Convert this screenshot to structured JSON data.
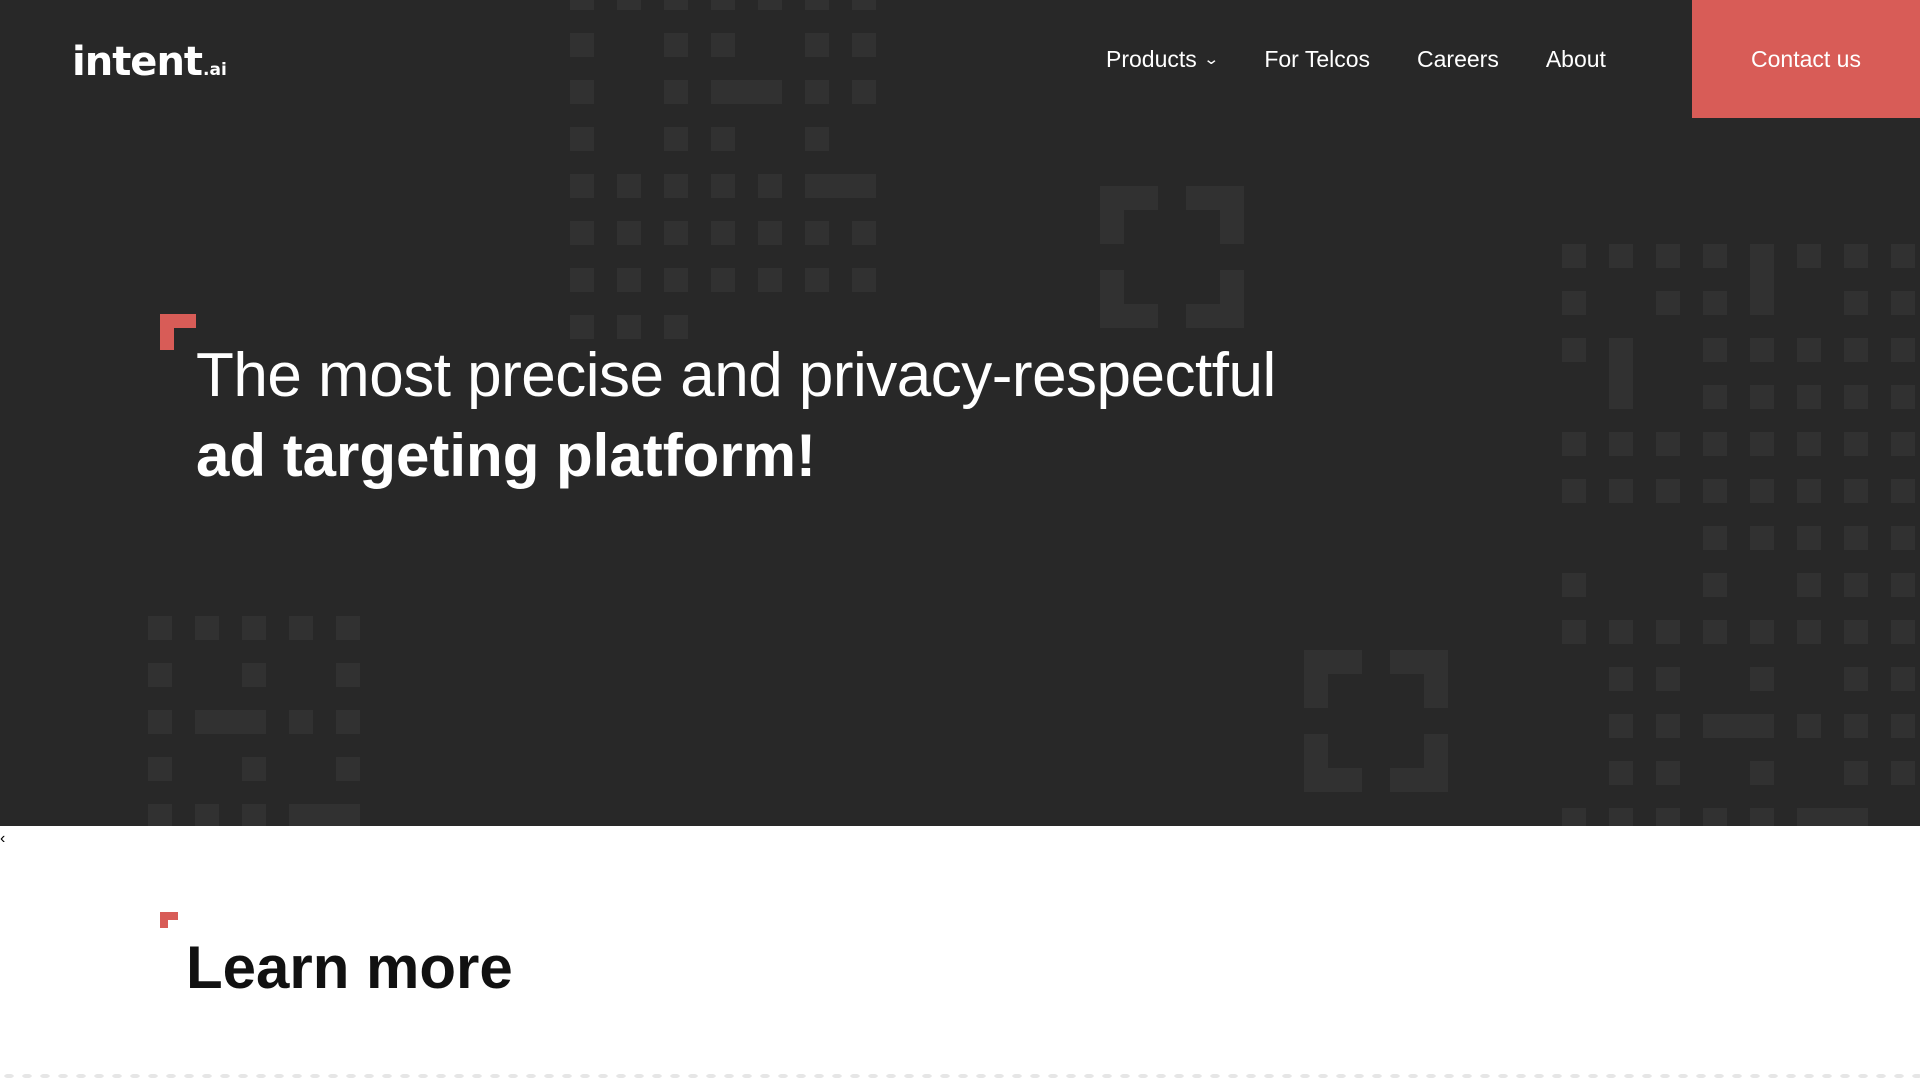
{
  "brand": {
    "logo_main": "intent",
    "logo_suffix": ".ai",
    "accent_color": "#d85c57",
    "hero_background": "#282828"
  },
  "nav": {
    "items": [
      {
        "label": "Products",
        "has_dropdown": true
      },
      {
        "label": "For Telcos",
        "has_dropdown": false
      },
      {
        "label": "Careers",
        "has_dropdown": false
      },
      {
        "label": "About",
        "has_dropdown": false
      }
    ],
    "dropdown_icon": "chevron-down-icon",
    "contact_label": "Contact us"
  },
  "hero": {
    "headline_line1": "The most precise and privacy-respectful",
    "headline_line2": "ad targeting platform!"
  },
  "carousel": {
    "prev_glyph": "‹",
    "prev_icon": "chevron-left-icon"
  },
  "learn_more": {
    "title": "Learn more"
  }
}
